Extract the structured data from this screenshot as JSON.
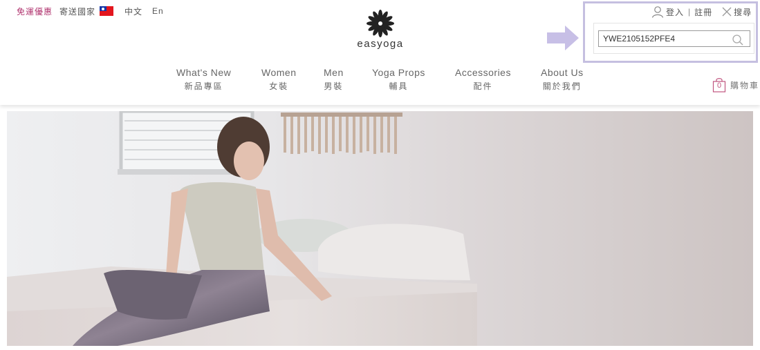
{
  "topbar": {
    "promo": "免運優惠",
    "ship_country": "寄送國家",
    "lang_zh": "中文",
    "lang_en": "En"
  },
  "logo": {
    "text": "easyoga"
  },
  "account": {
    "login": "登入",
    "separator": "|",
    "register": "註冊",
    "search_label": "搜尋"
  },
  "search": {
    "value": "YWE2105152PFE4"
  },
  "nav": [
    {
      "en": "What's New",
      "zh": "新品專區"
    },
    {
      "en": "Women",
      "zh": "女裝"
    },
    {
      "en": "Men",
      "zh": "男裝"
    },
    {
      "en": "Yoga Props",
      "zh": "輔具"
    },
    {
      "en": "Accessories",
      "zh": "配件"
    },
    {
      "en": "About Us",
      "zh": "關於我們"
    }
  ],
  "cart": {
    "count": "0",
    "label": "購物車"
  },
  "colors": {
    "promo": "#b0336e",
    "callout_border": "#c5bfe0",
    "arrow": "#c7bfe6",
    "cart_accent": "#c0557f"
  },
  "icons": [
    "user-icon",
    "close-icon",
    "search-icon",
    "arrow-icon",
    "cart-icon",
    "flag-icon",
    "lotus-logo-icon"
  ]
}
